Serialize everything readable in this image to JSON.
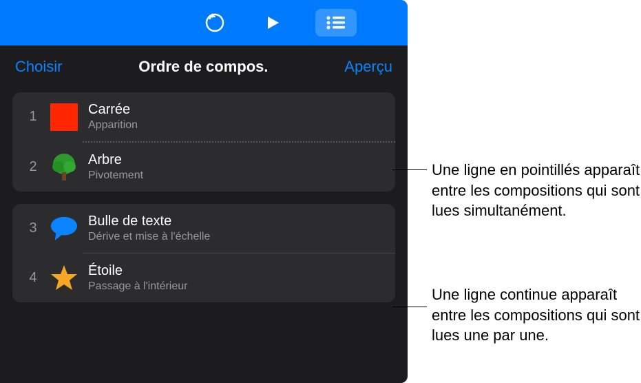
{
  "toolbar": {
    "undo_icon": "undo-icon",
    "play_icon": "play-icon",
    "list_icon": "list-icon"
  },
  "subheader": {
    "choose": "Choisir",
    "title": "Ordre de compos.",
    "preview": "Aperçu"
  },
  "groups": [
    {
      "divider": "dotted",
      "rows": [
        {
          "num": "1",
          "icon": "square",
          "title": "Carrée",
          "sub": "Apparition"
        },
        {
          "num": "2",
          "icon": "tree",
          "title": "Arbre",
          "sub": "Pivotement"
        }
      ]
    },
    {
      "divider": "solid",
      "rows": [
        {
          "num": "3",
          "icon": "speech",
          "title": "Bulle de texte",
          "sub": "Dérive et mise à l'échelle"
        },
        {
          "num": "4",
          "icon": "star",
          "title": "Étoile",
          "sub": "Passage à l'intérieur"
        }
      ]
    }
  ],
  "callouts": {
    "dotted": "Une ligne en pointillés apparaît entre les compositions qui sont lues simultanément.",
    "solid": "Une ligne continue apparaît entre les compositions qui sont lues une par une."
  }
}
